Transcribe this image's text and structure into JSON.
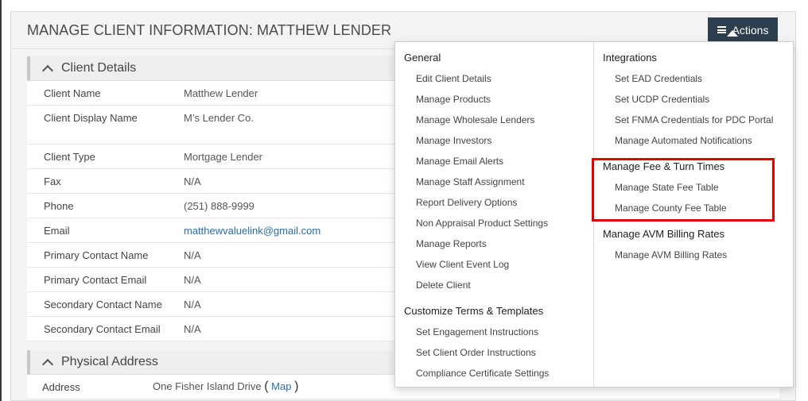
{
  "header": {
    "title": "MANAGE CLIENT INFORMATION: MATTHEW LENDER",
    "actions_label": "Actions"
  },
  "client_details": {
    "title": "Client Details",
    "rows": [
      {
        "label": "Client Name",
        "value": "Matthew Lender"
      },
      {
        "label": "Client Display Name",
        "value": "M’s Lender Co."
      },
      {
        "label": "Client Type",
        "value": "Mortgage Lender"
      },
      {
        "label": "Fax",
        "value": "N/A"
      },
      {
        "label": "Phone",
        "value": "(251) 888-9999"
      },
      {
        "label": "Email",
        "value": "matthewvaluelink@gmail.com"
      },
      {
        "label": "Primary Contact Name",
        "value": "N/A"
      },
      {
        "label": "Primary Contact Email",
        "value": "N/A"
      },
      {
        "label": "Secondary Contact Name",
        "value": "N/A"
      },
      {
        "label": "Secondary Contact Email",
        "value": "N/A"
      }
    ]
  },
  "physical_address": {
    "title": "Physical Address",
    "label": "Address",
    "value": "One Fisher Island Drive",
    "map_label": "Map",
    "paren_open": "(",
    "paren_close": ")"
  },
  "menu": {
    "general": {
      "title": "General",
      "items": [
        "Edit Client Details",
        "Manage Products",
        "Manage Wholesale Lenders",
        "Manage Investors",
        "Manage Email Alerts",
        "Manage Staff Assignment",
        "Report Delivery Options",
        "Non Appraisal Product Settings",
        "Manage Reports",
        "View Client Event Log",
        "Delete Client"
      ]
    },
    "customize": {
      "title": "Customize Terms & Templates",
      "items": [
        "Set Engagement Instructions",
        "Set Client Order Instructions",
        "Compliance Certificate Settings"
      ]
    },
    "integrations": {
      "title": "Integrations",
      "items": [
        "Set EAD Credentials",
        "Set UCDP Credentials",
        "Set FNMA Credentials for PDC Portal",
        "Manage Automated Notifications"
      ]
    },
    "fee": {
      "title": "Manage Fee & Turn Times",
      "items": [
        "Manage State Fee Table",
        "Manage County Fee Table"
      ]
    },
    "avm": {
      "title": "Manage AVM Billing Rates",
      "items": [
        "Manage AVM Billing Rates"
      ]
    }
  },
  "colors": {
    "actions_bg": "#2d3e4f",
    "link": "#2a6db0",
    "highlight": "#e00000"
  }
}
